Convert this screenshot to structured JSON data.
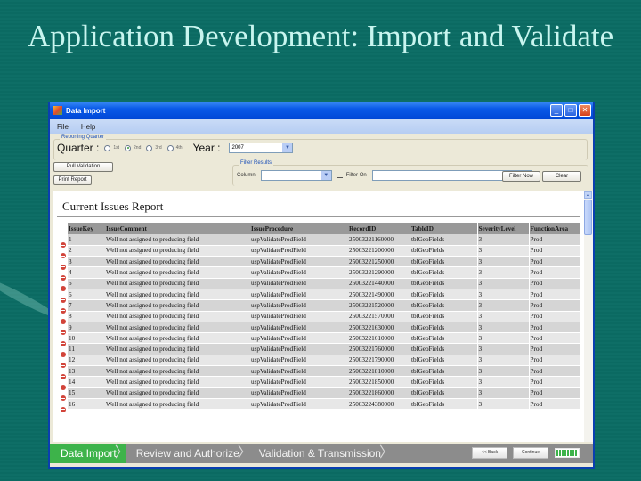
{
  "slide": {
    "title": "Application Development: Import and Validate"
  },
  "window": {
    "title": "Data Import",
    "controls": [
      "minimize",
      "maximize",
      "close"
    ]
  },
  "menu": [
    "File",
    "Help"
  ],
  "reporting_quarter": {
    "group_label": "Reporting Quarter",
    "quarter_label": "Quarter :",
    "options": [
      "1st",
      "2nd",
      "3rd",
      "4th"
    ],
    "selected": "2nd",
    "year_label": "Year :",
    "year_value": "2007"
  },
  "buttons": {
    "pull_validation": "Pull Validation",
    "print_report": "Print Report",
    "filter_now": "Filter Now",
    "clear": "Clear"
  },
  "filter": {
    "group_label": "Filter Results",
    "column_label": "Column",
    "column_value": "",
    "filter_on_label": "Filter On",
    "filter_on_checked": false,
    "filter_value": ""
  },
  "report": {
    "title": "Current Issues Report",
    "columns": [
      "IssueKey",
      "IssueComment",
      "IssueProcedure",
      "RecordID",
      "TableID",
      "SeverityLevel",
      "FunctionArea"
    ],
    "rows": [
      [
        "1",
        "Well not assigned to producing field",
        "uspValidateProdField",
        "25003221160000",
        "tblGeoFields",
        "3",
        "Prod"
      ],
      [
        "2",
        "Well not assigned to producing field",
        "uspValidateProdField",
        "25003221200000",
        "tblGeoFields",
        "3",
        "Prod"
      ],
      [
        "3",
        "Well not assigned to producing field",
        "uspValidateProdField",
        "25003221250000",
        "tblGeoFields",
        "3",
        "Prod"
      ],
      [
        "4",
        "Well not assigned to producing field",
        "uspValidateProdField",
        "25003221290000",
        "tblGeoFields",
        "3",
        "Prod"
      ],
      [
        "5",
        "Well not assigned to producing field",
        "uspValidateProdField",
        "25003221440000",
        "tblGeoFields",
        "3",
        "Prod"
      ],
      [
        "6",
        "Well not assigned to producing field",
        "uspValidateProdField",
        "25003221490000",
        "tblGeoFields",
        "3",
        "Prod"
      ],
      [
        "7",
        "Well not assigned to producing field",
        "uspValidateProdField",
        "25003221520000",
        "tblGeoFields",
        "3",
        "Prod"
      ],
      [
        "8",
        "Well not assigned to producing field",
        "uspValidateProdField",
        "25003221570000",
        "tblGeoFields",
        "3",
        "Prod"
      ],
      [
        "9",
        "Well not assigned to producing field",
        "uspValidateProdField",
        "25003221630000",
        "tblGeoFields",
        "3",
        "Prod"
      ],
      [
        "10",
        "Well not assigned to producing field",
        "uspValidateProdField",
        "25003221610000",
        "tblGeoFields",
        "3",
        "Prod"
      ],
      [
        "11",
        "Well not assigned to producing field",
        "uspValidateProdField",
        "25003221760000",
        "tblGeoFields",
        "3",
        "Prod"
      ],
      [
        "12",
        "Well not assigned to producing field",
        "uspValidateProdField",
        "25003221790000",
        "tblGeoFields",
        "3",
        "Prod"
      ],
      [
        "13",
        "Well not assigned to producing field",
        "uspValidateProdField",
        "25003221810000",
        "tblGeoFields",
        "3",
        "Prod"
      ],
      [
        "14",
        "Well not assigned to producing field",
        "uspValidateProdField",
        "25003221850000",
        "tblGeoFields",
        "3",
        "Prod"
      ],
      [
        "15",
        "Well not assigned to producing field",
        "uspValidateProdField",
        "25003221860000",
        "tblGeoFields",
        "3",
        "Prod"
      ],
      [
        "16",
        "Well not assigned to producing field",
        "uspValidateProdField",
        "25003224380000",
        "tblGeoFields",
        "3",
        "Prod"
      ]
    ]
  },
  "wizard": {
    "steps": [
      "Data Import",
      "Review and Authorize",
      "Validation & Transmission"
    ],
    "active_step": "Data Import",
    "back_label": "<< Back",
    "continue_label": "Continue",
    "progress": 1.0
  },
  "colors": {
    "slide_bg": "#0e6e66",
    "title_text": "#c8f5ef",
    "active_step": "#3db34a",
    "titlebar": "#0a5ae8",
    "error_icon": "#d2443a"
  }
}
